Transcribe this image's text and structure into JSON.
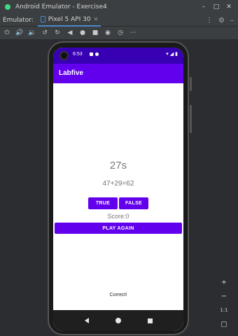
{
  "window": {
    "title": "Android Emulator - Exercise4"
  },
  "tabbar": {
    "label": "Emulator:",
    "tab_label": "Pixel 5 API 30"
  },
  "device": {
    "status_time": "6:53",
    "app_title": "Labfive",
    "timer": "27s",
    "question": "47+29=62",
    "true_label": "TRUE",
    "false_label": "FALSE",
    "score": "Score:0",
    "play_again_label": "PLAY AGAIN",
    "result": "Correct!"
  },
  "side": {
    "zoom_in": "+",
    "zoom_out": "−",
    "one_to_one": "1:1"
  },
  "colors": {
    "primary": "#6200ee",
    "primary_dark": "#3700b3"
  }
}
